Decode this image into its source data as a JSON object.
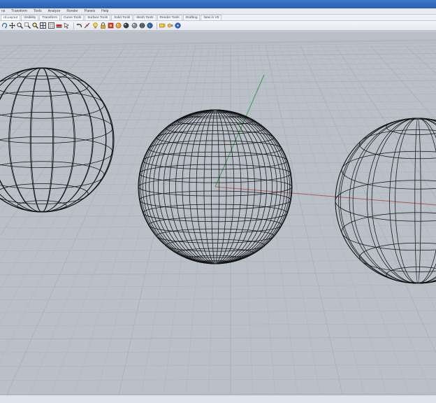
{
  "menu": {
    "items": [
      "ns",
      "Transform",
      "Tools",
      "Analyze",
      "Render",
      "Panels",
      "Help"
    ]
  },
  "tabs": {
    "items": [
      "rd Layout",
      "Visibility",
      "Transform",
      "Curve Tools",
      "Surface Tools",
      "Solid Tools",
      "Mesh Tools",
      "Render Tools",
      "Drafting",
      "New in V5"
    ]
  },
  "toolbar": {
    "icons": [
      "rotate-icon",
      "pan-icon",
      "zoom-extents-icon",
      "zoom-window-icon",
      "zoom-selected-icon",
      "four-viewports-icon",
      "grid-icon",
      "layer-icon",
      "select-arrow-icon",
      "undo-icon",
      "snap-icon",
      "lightbulb-icon",
      "lock-icon",
      "shade-icon",
      "render-icon",
      "rendered-sphere-icon",
      "ghosted-icon",
      "xray-icon",
      "globe-icon",
      "materials-icon",
      "lights-icon",
      "help-icon"
    ]
  },
  "viewport": {
    "background": "#b9c0c8",
    "grid_color": "#a9b0b9",
    "wire_color": "#111111",
    "x_axis_color": "#b25a55",
    "y_axis_color": "#3a9a46"
  }
}
